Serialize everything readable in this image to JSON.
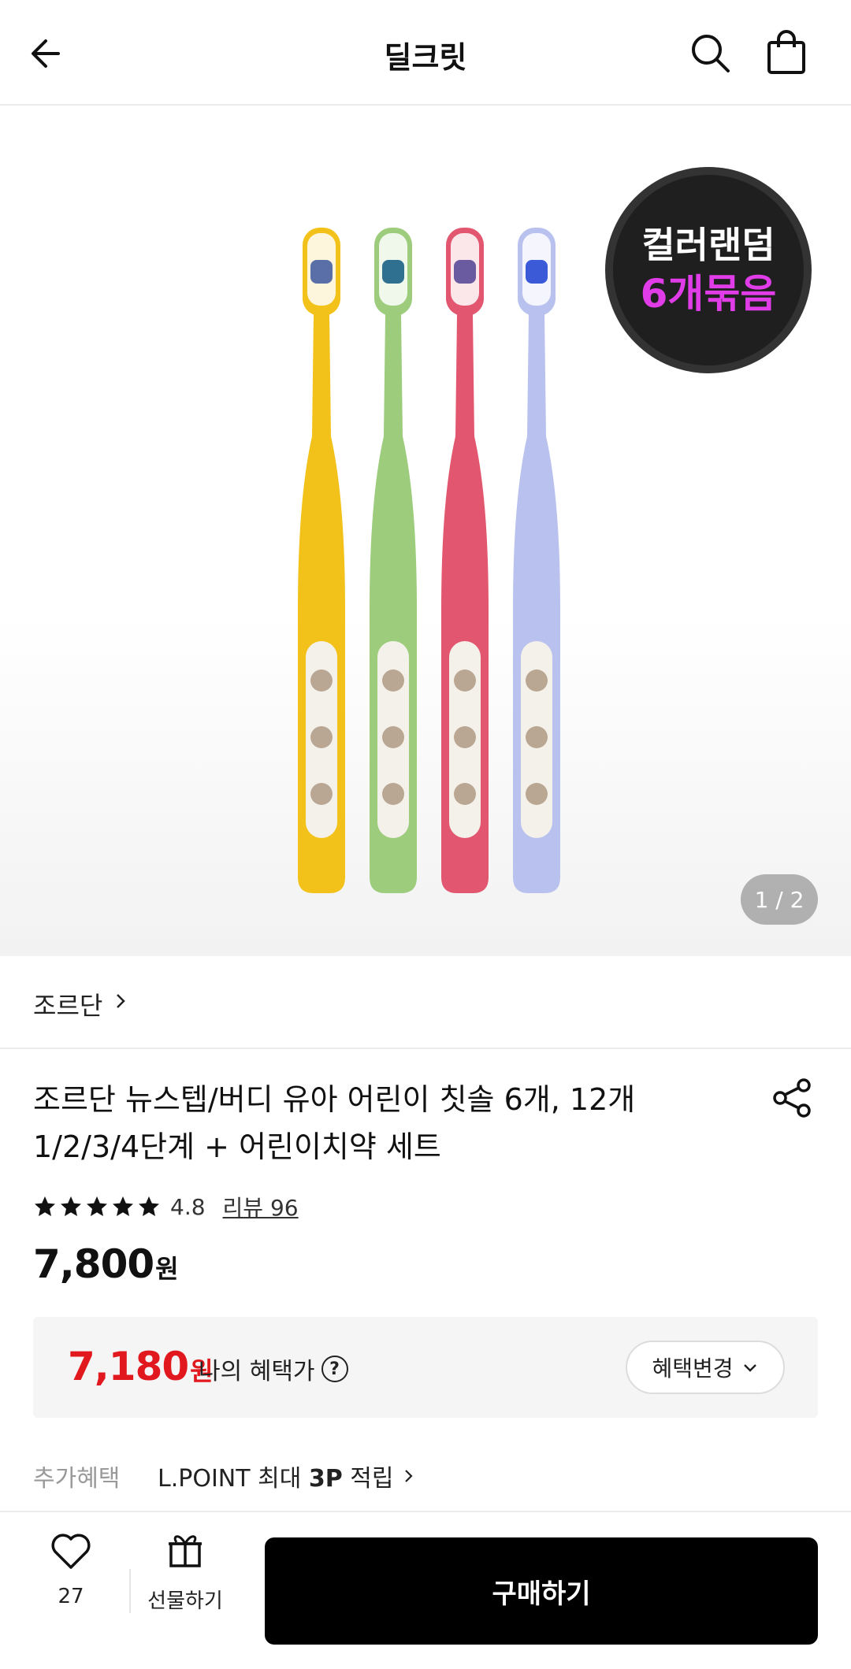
{
  "header": {
    "title": "딜크릿",
    "back_icon": "arrow-left-icon",
    "search_icon": "search-icon",
    "bag_icon": "shopping-bag-icon"
  },
  "gallery": {
    "badge_line1": "컬러랜덤",
    "badge_line2": "6개묶음",
    "pager": "1 / 2",
    "toothbrush_colors": [
      "#f2c21a",
      "#9ccc7c",
      "#e2576f",
      "#b9c1ef"
    ]
  },
  "brand": {
    "name": "조르단"
  },
  "product": {
    "title_line1": "조르단 뉴스텝/버디 유아 어린이 칫솔 6개, 12개",
    "title_line2": "1/2/3/4단계 + 어린이치약 세트",
    "rating": "4.8",
    "stars": 5,
    "review": "리뷰 96",
    "price": "7,800",
    "price_unit": "원"
  },
  "benefit": {
    "price": "7,180",
    "price_unit": "원",
    "label": "나의 혜택가",
    "help": "?",
    "change_button": "혜택변경",
    "accent_color": "#e1181d"
  },
  "extra": {
    "label": "추가혜택",
    "text_pre": "L.POINT 최대 ",
    "text_bold": "3P",
    "text_post": " 적립"
  },
  "bottom": {
    "likes_count": "27",
    "gift_label": "선물하기",
    "buy_label": "구매하기"
  }
}
